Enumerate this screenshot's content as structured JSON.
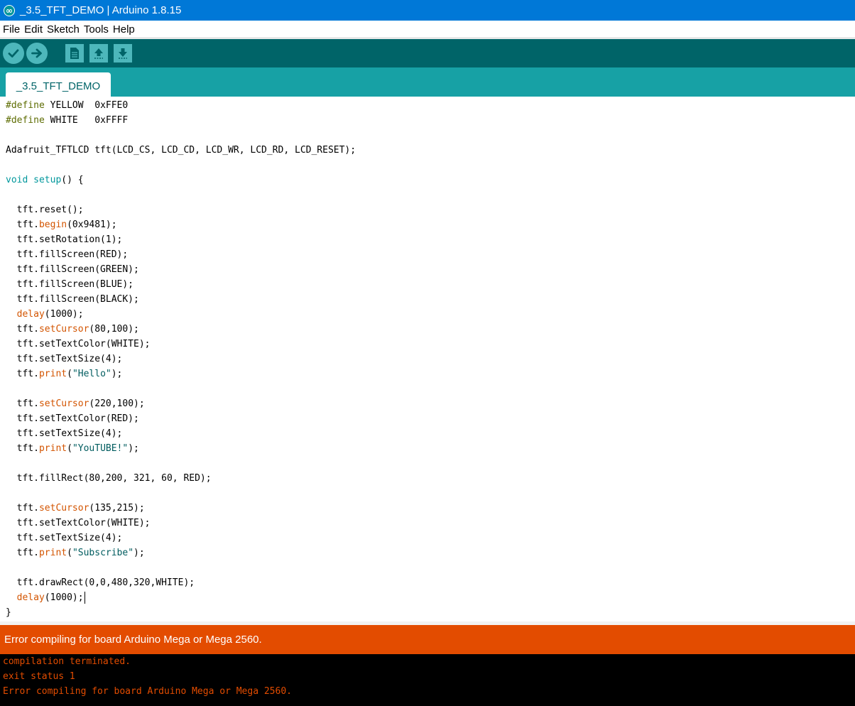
{
  "window": {
    "title": "_3.5_TFT_DEMO | Arduino 1.8.15",
    "app_icon": "arduino-icon"
  },
  "menu": [
    "File",
    "Edit",
    "Sketch",
    "Tools",
    "Help"
  ],
  "toolbar": {
    "buttons": [
      "verify-icon",
      "upload-icon",
      "new-icon",
      "open-icon",
      "save-icon"
    ]
  },
  "tab": {
    "label": "_3.5_TFT_DEMO"
  },
  "code": {
    "lines": [
      [
        [
          "pre",
          "#define"
        ],
        [
          "",
          " YELLOW  0xFFE0"
        ]
      ],
      [
        [
          "pre",
          "#define"
        ],
        [
          "",
          " WHITE   0xFFFF"
        ]
      ],
      [],
      [
        [
          "",
          "Adafruit_TFTLCD tft(LCD_CS, LCD_CD, LCD_WR, LCD_RD, LCD_RESET);"
        ]
      ],
      [],
      [
        [
          "type",
          "void"
        ],
        [
          "",
          " "
        ],
        [
          "type",
          "setup"
        ],
        [
          "",
          "() {"
        ]
      ],
      [],
      [
        [
          "",
          "  tft.reset();"
        ]
      ],
      [
        [
          "",
          "  tft."
        ],
        [
          "fn",
          "begin"
        ],
        [
          "",
          "(0x9481);"
        ]
      ],
      [
        [
          "",
          "  tft.setRotation(1);"
        ]
      ],
      [
        [
          "",
          "  tft.fillScreen(RED);"
        ]
      ],
      [
        [
          "",
          "  tft.fillScreen(GREEN);"
        ]
      ],
      [
        [
          "",
          "  tft.fillScreen(BLUE);"
        ]
      ],
      [
        [
          "",
          "  tft.fillScreen(BLACK);"
        ]
      ],
      [
        [
          "",
          "  "
        ],
        [
          "fn",
          "delay"
        ],
        [
          "",
          "(1000);"
        ]
      ],
      [
        [
          "",
          "  tft."
        ],
        [
          "fn",
          "setCursor"
        ],
        [
          "",
          "(80,100);"
        ]
      ],
      [
        [
          "",
          "  tft.setTextColor(WHITE);"
        ]
      ],
      [
        [
          "",
          "  tft.setTextSize(4);"
        ]
      ],
      [
        [
          "",
          "  tft."
        ],
        [
          "fn",
          "print"
        ],
        [
          "",
          "("
        ],
        [
          "str",
          "\"Hello\""
        ],
        [
          "",
          ");"
        ]
      ],
      [],
      [
        [
          "",
          "  tft."
        ],
        [
          "fn",
          "setCursor"
        ],
        [
          "",
          "(220,100);"
        ]
      ],
      [
        [
          "",
          "  tft.setTextColor(RED);"
        ]
      ],
      [
        [
          "",
          "  tft.setTextSize(4);"
        ]
      ],
      [
        [
          "",
          "  tft."
        ],
        [
          "fn",
          "print"
        ],
        [
          "",
          "("
        ],
        [
          "str",
          "\"YouTUBE!\""
        ],
        [
          "",
          ");"
        ]
      ],
      [],
      [
        [
          "",
          "  tft.fillRect(80,200, 321, 60, RED);"
        ]
      ],
      [],
      [
        [
          "",
          "  tft."
        ],
        [
          "fn",
          "setCursor"
        ],
        [
          "",
          "(135,215);"
        ]
      ],
      [
        [
          "",
          "  tft.setTextColor(WHITE);"
        ]
      ],
      [
        [
          "",
          "  tft.setTextSize(4);"
        ]
      ],
      [
        [
          "",
          "  tft."
        ],
        [
          "fn",
          "print"
        ],
        [
          "",
          "("
        ],
        [
          "str",
          "\"Subscribe\""
        ],
        [
          "",
          ");"
        ]
      ],
      [],
      [
        [
          "",
          "  tft.drawRect(0,0,480,320,WHITE);"
        ]
      ],
      [
        [
          "",
          "  "
        ],
        [
          "fn",
          "delay"
        ],
        [
          "",
          "(1000);"
        ]
      ],
      [
        [
          "",
          "}"
        ]
      ]
    ],
    "caret_line": 33
  },
  "status": {
    "message": "Error compiling for board Arduino Mega or Mega 2560."
  },
  "console": {
    "lines": [
      "compilation terminated.",
      "exit status 1",
      "Error compiling for board Arduino Mega or Mega 2560."
    ]
  },
  "colors": {
    "title_bar": "#0078d7",
    "toolbar": "#006468",
    "tab_bar": "#17a1a5",
    "toolbar_button": "#4db7bb",
    "error_bar": "#e34c00",
    "console_text": "#e34c00",
    "keyword_preprocessor": "#5e6d03",
    "keyword_type": "#00979c",
    "keyword_function": "#d35400",
    "string_literal": "#005c5f"
  }
}
